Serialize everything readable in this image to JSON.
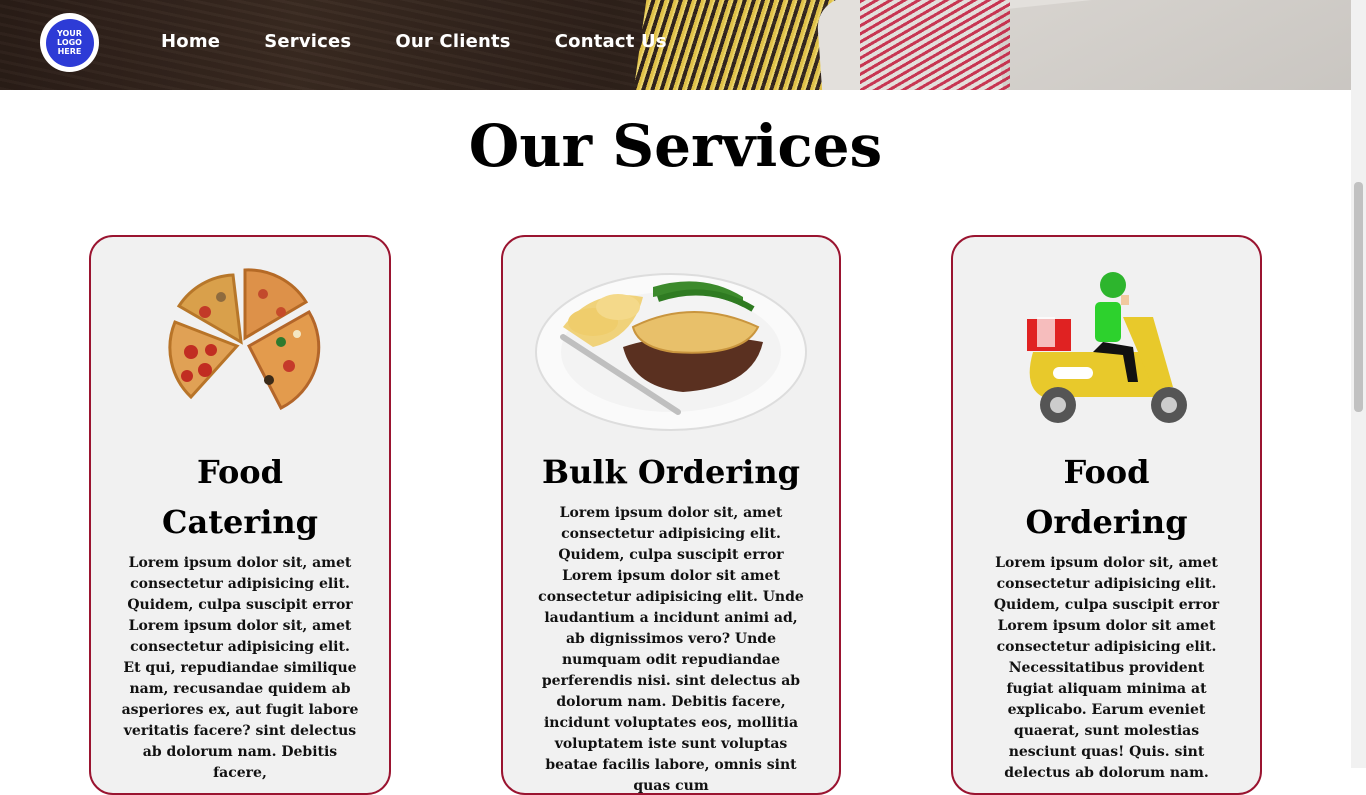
{
  "header": {
    "logo_text": "YOUR\nLOGO\nHERE",
    "nav": [
      "Home",
      "Services",
      "Our Clients",
      "Contact Us"
    ]
  },
  "page_title": "Our Services",
  "cards": [
    {
      "title": "Food Catering",
      "image_icon": "pizza-slices",
      "text": "Lorem ipsum dolor sit, amet consectetur adipisicing elit. Quidem, culpa suscipit error Lorem ipsum dolor sit, amet consectetur adipisicing elit. Et qui, repudiandae similique nam, recusandae quidem ab asperiores ex, aut fugit labore veritatis facere? sint delectus ab dolorum nam. Debitis facere,"
    },
    {
      "title": "Bulk Ordering",
      "image_icon": "pie-plate",
      "text": "Lorem ipsum dolor sit, amet consectetur adipisicing elit. Quidem, culpa suscipit error Lorem ipsum dolor sit amet consectetur adipisicing elit. Unde laudantium a incidunt animi ad, ab dignissimos vero? Unde numquam odit repudiandae perferendis nisi. sint delectus ab dolorum nam. Debitis facere, incidunt voluptates eos, mollitia voluptatem iste sunt voluptas beatae facilis labore, omnis sint quas cum"
    },
    {
      "title": "Food Ordering",
      "image_icon": "delivery-scooter",
      "text": "Lorem ipsum dolor sit, amet consectetur adipisicing elit. Quidem, culpa suscipit error Lorem ipsum dolor sit amet consectetur adipisicing elit. Necessitatibus provident fugiat aliquam minima at explicabo. Earum eveniet quaerat, sunt molestias nesciunt quas! Quis. sint delectus ab dolorum nam."
    }
  ],
  "colors": {
    "card_border": "#9a1430",
    "card_bg": "#f1f1f1",
    "logo_blue": "#2d3bd6"
  }
}
